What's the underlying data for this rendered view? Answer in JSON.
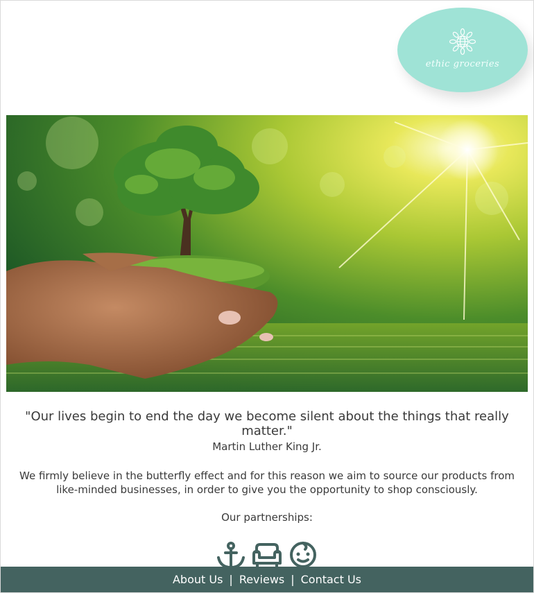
{
  "brand": {
    "name": "ethic groceries",
    "logo_icon": "globe-sunburst-icon",
    "logo_color": "#9fe3d6"
  },
  "hero": {
    "image": "hands-holding-tree-sunlight"
  },
  "content": {
    "quote": "\"Our lives begin to end the day we become silent about the things that really matter.\"",
    "author": "Martin Luther King Jr.",
    "belief": "We firmly believe in the butterfly effect and for this reason we aim to source our products from like-minded businesses, in order to give you the opportunity to shop consciously.",
    "partnerships_label": "Our partnerships:",
    "partner_icons": [
      "anchor-icon",
      "sofa-icon",
      "baby-face-icon"
    ],
    "icon_color": "#446360"
  },
  "footer": {
    "links": [
      "About Us",
      "Reviews",
      "Contact Us"
    ],
    "separator": "|",
    "background": "#446360"
  }
}
